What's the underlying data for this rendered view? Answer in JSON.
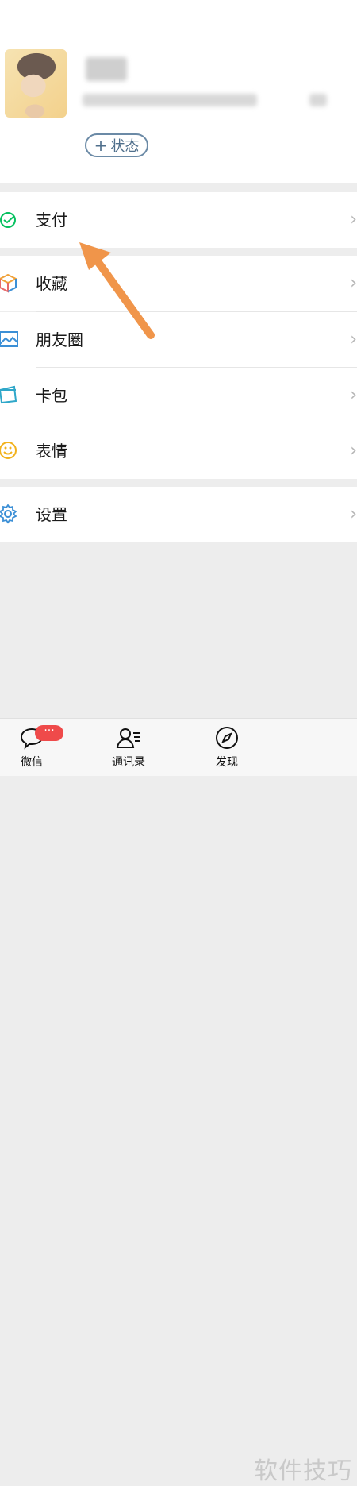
{
  "profile": {
    "status_button": "状态",
    "plus_symbol": "+"
  },
  "menu": {
    "pay": "支付",
    "favorites": "收藏",
    "moments": "朋友圈",
    "cards": "卡包",
    "stickers": "表情",
    "settings": "设置",
    "chevron": "›"
  },
  "tabbar": {
    "chats": "微信",
    "contacts": "通讯录",
    "discover": "发现",
    "chats_badge": "···"
  },
  "watermark": "软件技巧",
  "colors": {
    "pay_green": "#07c160",
    "arrow_orange": "#f0954a",
    "badge_red": "#ef4a4a",
    "status_blue": "#6b8aa6"
  }
}
